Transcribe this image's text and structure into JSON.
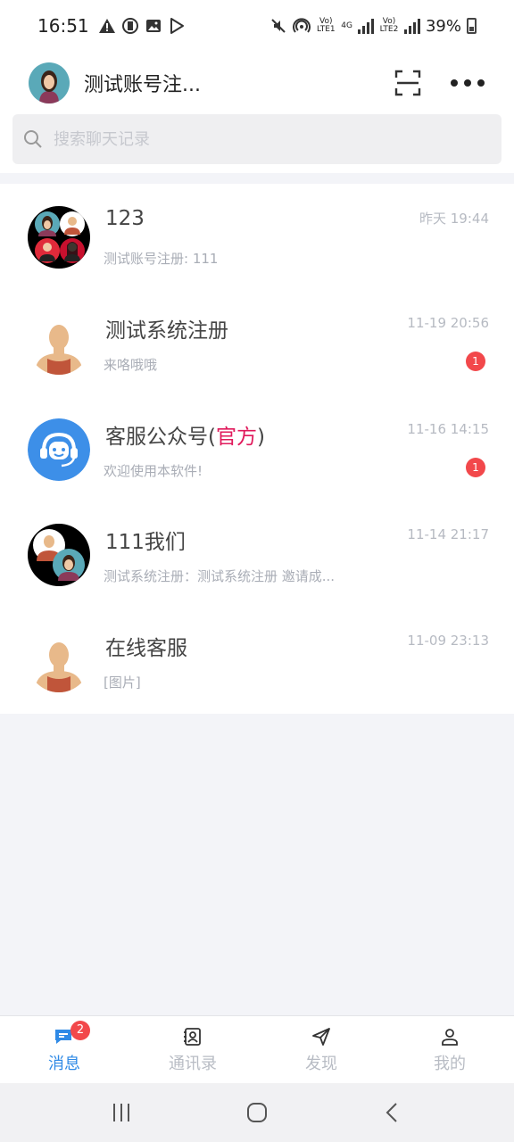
{
  "status_bar": {
    "time": "16:51",
    "net1": "Vo) LTE1",
    "net2": "Vo) LTE2",
    "net_type": "4G",
    "battery": "39%",
    "icons": [
      "warning-icon",
      "sim-icon",
      "image-icon",
      "play-store-icon",
      "mute-icon",
      "hotspot-icon",
      "signal-icon",
      "battery-icon"
    ]
  },
  "header": {
    "title": "测试账号注...",
    "icons": [
      "scan-icon",
      "more-icon"
    ]
  },
  "search": {
    "placeholder": "搜索聊天记录"
  },
  "chats": [
    {
      "name": "123",
      "time": "昨天 19:44",
      "preview": "测试账号注册: 111",
      "unread": "",
      "avatar": "group-avatar"
    },
    {
      "name": "测试系统注册",
      "time": "11-19 20:56",
      "preview": "来咯哦哦",
      "unread": "1",
      "avatar": "man-avatar"
    },
    {
      "name_prefix": "客服公众号(",
      "name_official": "官方",
      "name_suffix": ")",
      "time": "11-16 14:15",
      "preview": "欢迎使用本软件!",
      "unread": "1",
      "avatar": "service-avatar"
    },
    {
      "name": "111我们",
      "time": "11-14 21:17",
      "preview": "测试系统注册：测试系统注册 邀请成...",
      "unread": "",
      "avatar": "group-avatar"
    },
    {
      "name": "在线客服",
      "time": "11-09 23:13",
      "preview": "[图片]",
      "unread": "",
      "avatar": "man-avatar"
    }
  ],
  "tabs": [
    {
      "label": "消息",
      "badge": "2",
      "active": true,
      "icon": "message-icon"
    },
    {
      "label": "通讯录",
      "active": false,
      "icon": "contacts-icon"
    },
    {
      "label": "发现",
      "active": false,
      "icon": "discover-icon"
    },
    {
      "label": "我的",
      "active": false,
      "icon": "profile-icon"
    }
  ],
  "colors": {
    "accent": "#2f8ae6",
    "badge": "#f2484b",
    "official": "#e0195b"
  }
}
